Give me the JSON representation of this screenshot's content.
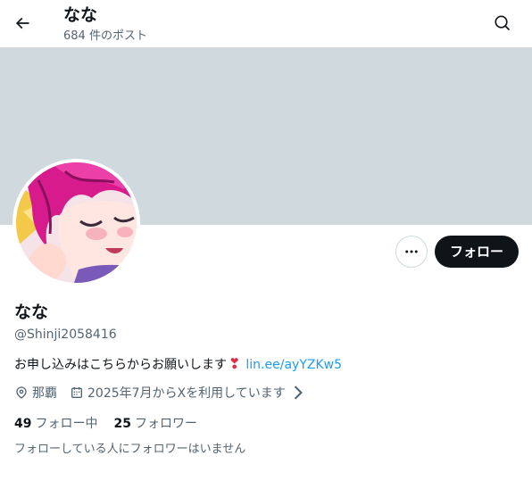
{
  "header": {
    "title": "なな",
    "post_count": "684 件のポスト"
  },
  "icons": {
    "back": "arrow-left-icon",
    "search": "search-icon",
    "more": "more-horizontal-icon",
    "location": "location-pin-icon",
    "calendar": "calendar-icon",
    "chevron": "chevron-right-icon"
  },
  "colors": {
    "banner": "#cfd9de",
    "follow_button_bg": "#0f1419",
    "link": "#1d9bf0",
    "secondary_text": "#536471",
    "heart": "#dd2e44"
  },
  "profile": {
    "display_name": "なな",
    "handle": "@Shinji2058416",
    "bio_text": "お申し込みはこちらからお願いします",
    "bio_emoji": "❣",
    "bio_link": "lin.ee/ayYZKw5",
    "location": "那覇",
    "joined": "2025年7月からXを利用しています"
  },
  "actions": {
    "follow_label": "フォロー"
  },
  "stats": {
    "following_count": "49",
    "following_label": "フォロー中",
    "followers_count": "25",
    "followers_label": "フォロワー"
  },
  "footer_note": "フォローしている人にフォロワーはいません"
}
